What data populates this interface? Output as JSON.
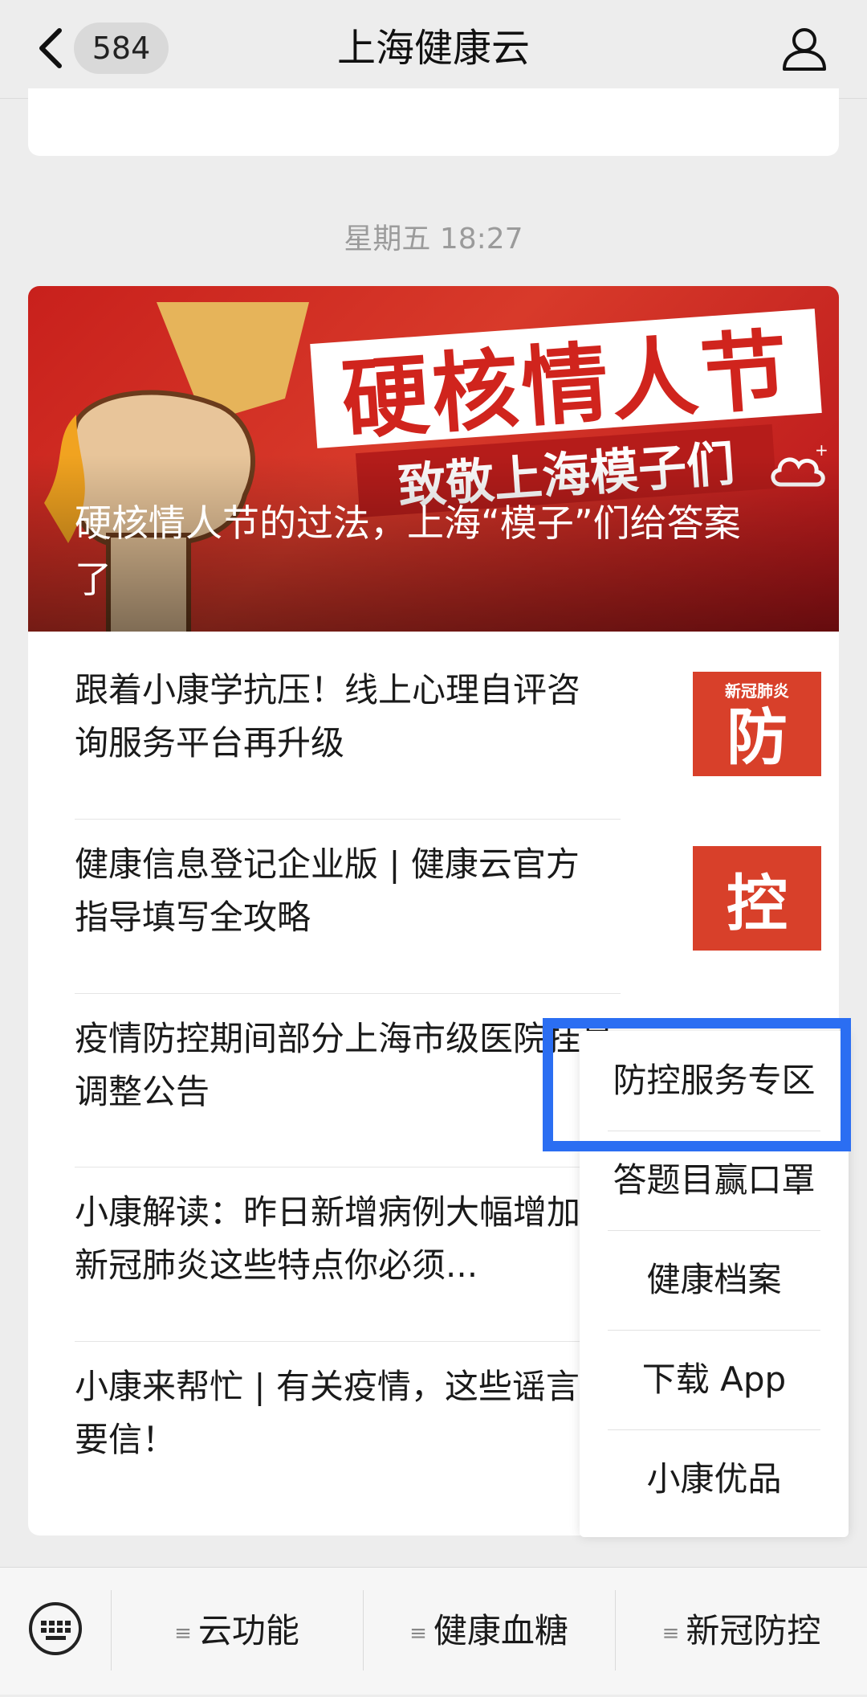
{
  "nav": {
    "badge": "584",
    "title": "上海健康云"
  },
  "timestamp": "星期五 18:27",
  "banner": {
    "headline": "硬核情人节",
    "subline": "致敬上海模子们",
    "caption": "硬核情人节的过法，上海“模子”们给答案了"
  },
  "articles": [
    {
      "title": "跟着小康学抗压！线上心理自评咨询服务平台再升级",
      "thumb": "防",
      "thumb_tag": "新冠肺炎"
    },
    {
      "title": "健康信息登记企业版 | 健康云官方指导填写全攻略",
      "thumb": "控"
    },
    {
      "title": "疫情防控期间部分上海市级医院挂号调整公告"
    },
    {
      "title": "小康解读：昨日新增病例大幅增加？新冠肺炎这些特点你必须..."
    },
    {
      "title": "小康来帮忙 | 有关疫情，这些谣言不要信！"
    }
  ],
  "menu": {
    "items": [
      "防控服务专区",
      "答题目赢口罩",
      "健康档案",
      "下载 App",
      "小康优品"
    ]
  },
  "tabbar": {
    "tabs": [
      "云功能",
      "健康血糖",
      "新冠防控"
    ]
  },
  "colors": {
    "highlight": "#2b6ef2",
    "banner_red": "#c8201c"
  }
}
